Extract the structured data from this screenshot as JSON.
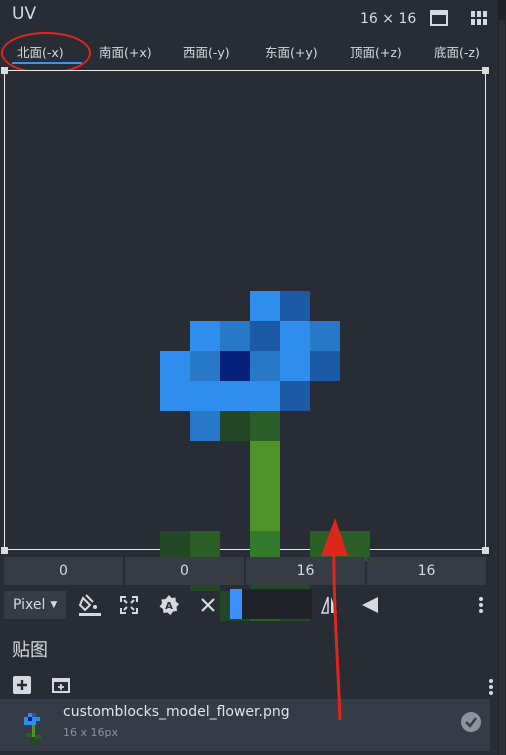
{
  "header": {
    "title": "UV",
    "size_label": "16 × 16"
  },
  "tabs": [
    {
      "label": "北面(-x)",
      "active": true
    },
    {
      "label": "南面(+x)"
    },
    {
      "label": "西面(-y)"
    },
    {
      "label": "东面(+y)"
    },
    {
      "label": "顶面(+z)"
    },
    {
      "label": "底面(-z)"
    }
  ],
  "uv_coords": [
    "0",
    "0",
    "16",
    "16"
  ],
  "toolbar": {
    "mode": "Pixel",
    "icons": [
      "paint-bucket-icon",
      "fullscreen-icon",
      "auto-uv-icon",
      "clear-icon",
      "mirror-x-icon",
      "mirror-y-icon",
      "more-icon"
    ],
    "selected_color": "#3d8fff"
  },
  "textures_section": {
    "title": "贴图",
    "items": [
      {
        "name": "customblocks_model_flower.png",
        "dimensions": "16 x 16px"
      }
    ]
  },
  "colors": {
    "accent": "#3e90ff",
    "annotation": "#e0261b",
    "panel_bg": "#282c34"
  }
}
